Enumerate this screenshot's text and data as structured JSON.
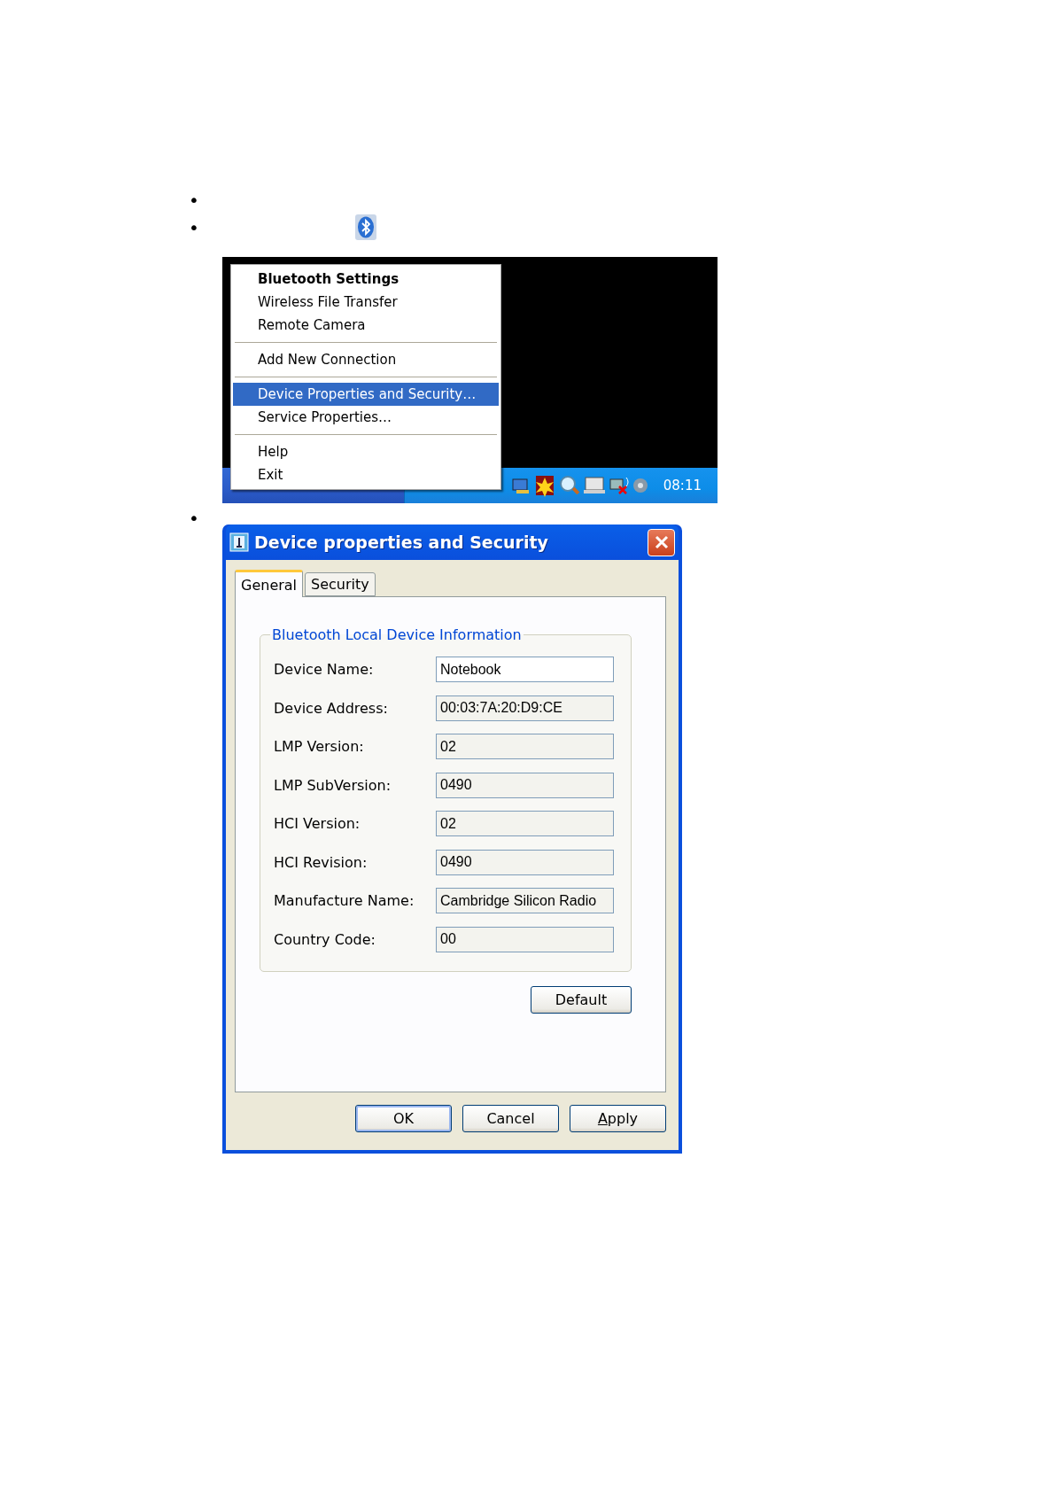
{
  "bullets": [
    {
      "marker": "•",
      "kind": "blank"
    },
    {
      "marker": "•",
      "kind": "icon"
    },
    {
      "marker": "•",
      "kind": "dialog"
    }
  ],
  "context_menu": {
    "groups": [
      [
        {
          "label": "Bluetooth Settings",
          "bold": true,
          "selected": false
        },
        {
          "label": "Wireless File Transfer",
          "bold": false,
          "selected": false
        },
        {
          "label": "Remote Camera",
          "bold": false,
          "selected": false
        }
      ],
      [
        {
          "label": "Add New Connection",
          "bold": false,
          "selected": false
        }
      ],
      [
        {
          "label": "Device Properties and Security…",
          "bold": false,
          "selected": true
        },
        {
          "label": "Service Properties…",
          "bold": false,
          "selected": false
        }
      ],
      [
        {
          "label": "Help",
          "bold": false,
          "selected": false
        },
        {
          "label": "Exit",
          "bold": false,
          "selected": false
        }
      ]
    ],
    "clock": "08:11"
  },
  "dialog": {
    "title": "Device properties and Security",
    "tabs": [
      {
        "label": "General",
        "selected": true
      },
      {
        "label": "Security",
        "selected": false
      }
    ],
    "group_title": "Bluetooth Local Device Information",
    "fields": [
      {
        "label": "Device Name:",
        "value": "Notebook",
        "editable": true
      },
      {
        "label": "Device Address:",
        "value": "00:03:7A:20:D9:CE",
        "editable": false
      },
      {
        "label": "LMP Version:",
        "value": "02",
        "editable": false
      },
      {
        "label": "LMP SubVersion:",
        "value": "0490",
        "editable": false
      },
      {
        "label": "HCI Version:",
        "value": "02",
        "editable": false
      },
      {
        "label": "HCI Revision:",
        "value": "0490",
        "editable": false
      },
      {
        "label": "Manufacture Name:",
        "value": "Cambridge Silicon Radio",
        "editable": false
      },
      {
        "label": "Country Code:",
        "value": "00",
        "editable": false
      }
    ],
    "default_button": "Default",
    "buttons": [
      {
        "label": "OK",
        "default": true
      },
      {
        "label": "Cancel",
        "default": false
      },
      {
        "label": "Apply",
        "default": false,
        "underline_first": true
      }
    ]
  }
}
